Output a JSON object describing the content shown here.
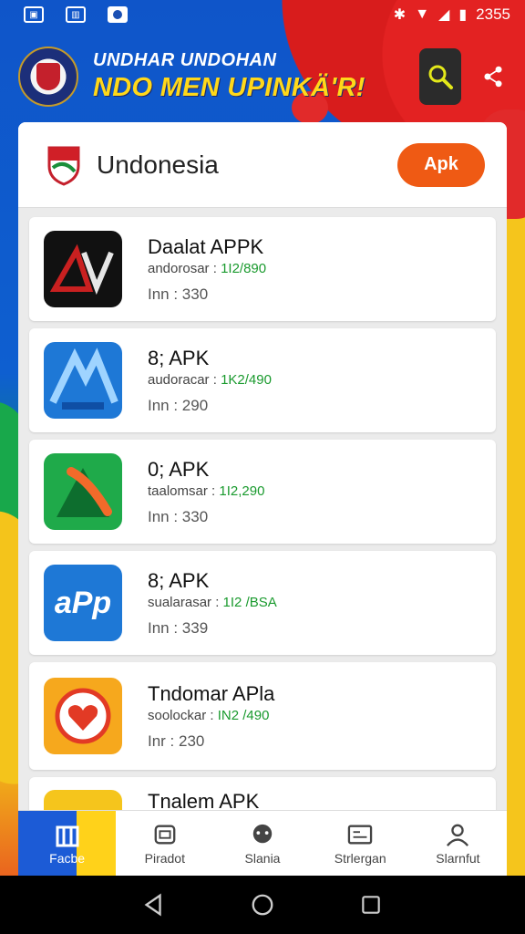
{
  "status_bar": {
    "time": "2355",
    "icons": [
      "image-icon",
      "grid-icon",
      "notification-icon"
    ],
    "right_icons": [
      "bluetooth-icon",
      "wifi-icon",
      "signal-icon",
      "battery-icon"
    ]
  },
  "header": {
    "title_top": "UNDHAR UNDOHAN",
    "title_main": "NDO MEN UPINKÄ'R!",
    "colors": {
      "title_top": "#ffffff",
      "title_main": "#ffd81a"
    }
  },
  "card": {
    "title": "Undonesia",
    "button_label": "Apk",
    "button_color": "#ef5a14"
  },
  "apps": [
    {
      "name": "Daalat APPK",
      "meta_label": "andorosar :",
      "version": "1I2/890",
      "installs": "Inn : 330",
      "icon": "av-icon",
      "icon_color": "#111111"
    },
    {
      "name": "8; APK",
      "meta_label": "audoracar :",
      "version": "1K2/490",
      "installs": "Inn : 290",
      "icon": "a-icon",
      "icon_color": "#1e78d6"
    },
    {
      "name": "0; APK",
      "meta_label": "taalomsar :",
      "version": "1I2,290",
      "installs": "Inn : 330",
      "icon": "triangle-icon",
      "icon_color": "#1faa4a"
    },
    {
      "name": "8; APK",
      "meta_label": "sualarasar :",
      "version": "1I2 /BSA",
      "installs": "Inn : 339",
      "icon": "app-icon",
      "icon_color": "#1e78d6"
    },
    {
      "name": "Tndomar APla",
      "meta_label": "soolockar :",
      "version": "IN2 /490",
      "installs": "Inr : 230",
      "icon": "heart-icon",
      "icon_color": "#f6a81d"
    },
    {
      "name": "Tnalem APK",
      "meta_label": "",
      "version": "",
      "installs": "",
      "icon": "partial-icon",
      "icon_color": "#f5c51c"
    }
  ],
  "bottom_nav": [
    {
      "label": "Facbe",
      "icon": "home-icon",
      "active": true
    },
    {
      "label": "Piradot",
      "icon": "store-icon",
      "active": false
    },
    {
      "label": "Slania",
      "icon": "chat-icon",
      "active": false
    },
    {
      "label": "Strlergan",
      "icon": "card-icon",
      "active": false
    },
    {
      "label": "Slarnfut",
      "icon": "person-icon",
      "active": false
    }
  ]
}
